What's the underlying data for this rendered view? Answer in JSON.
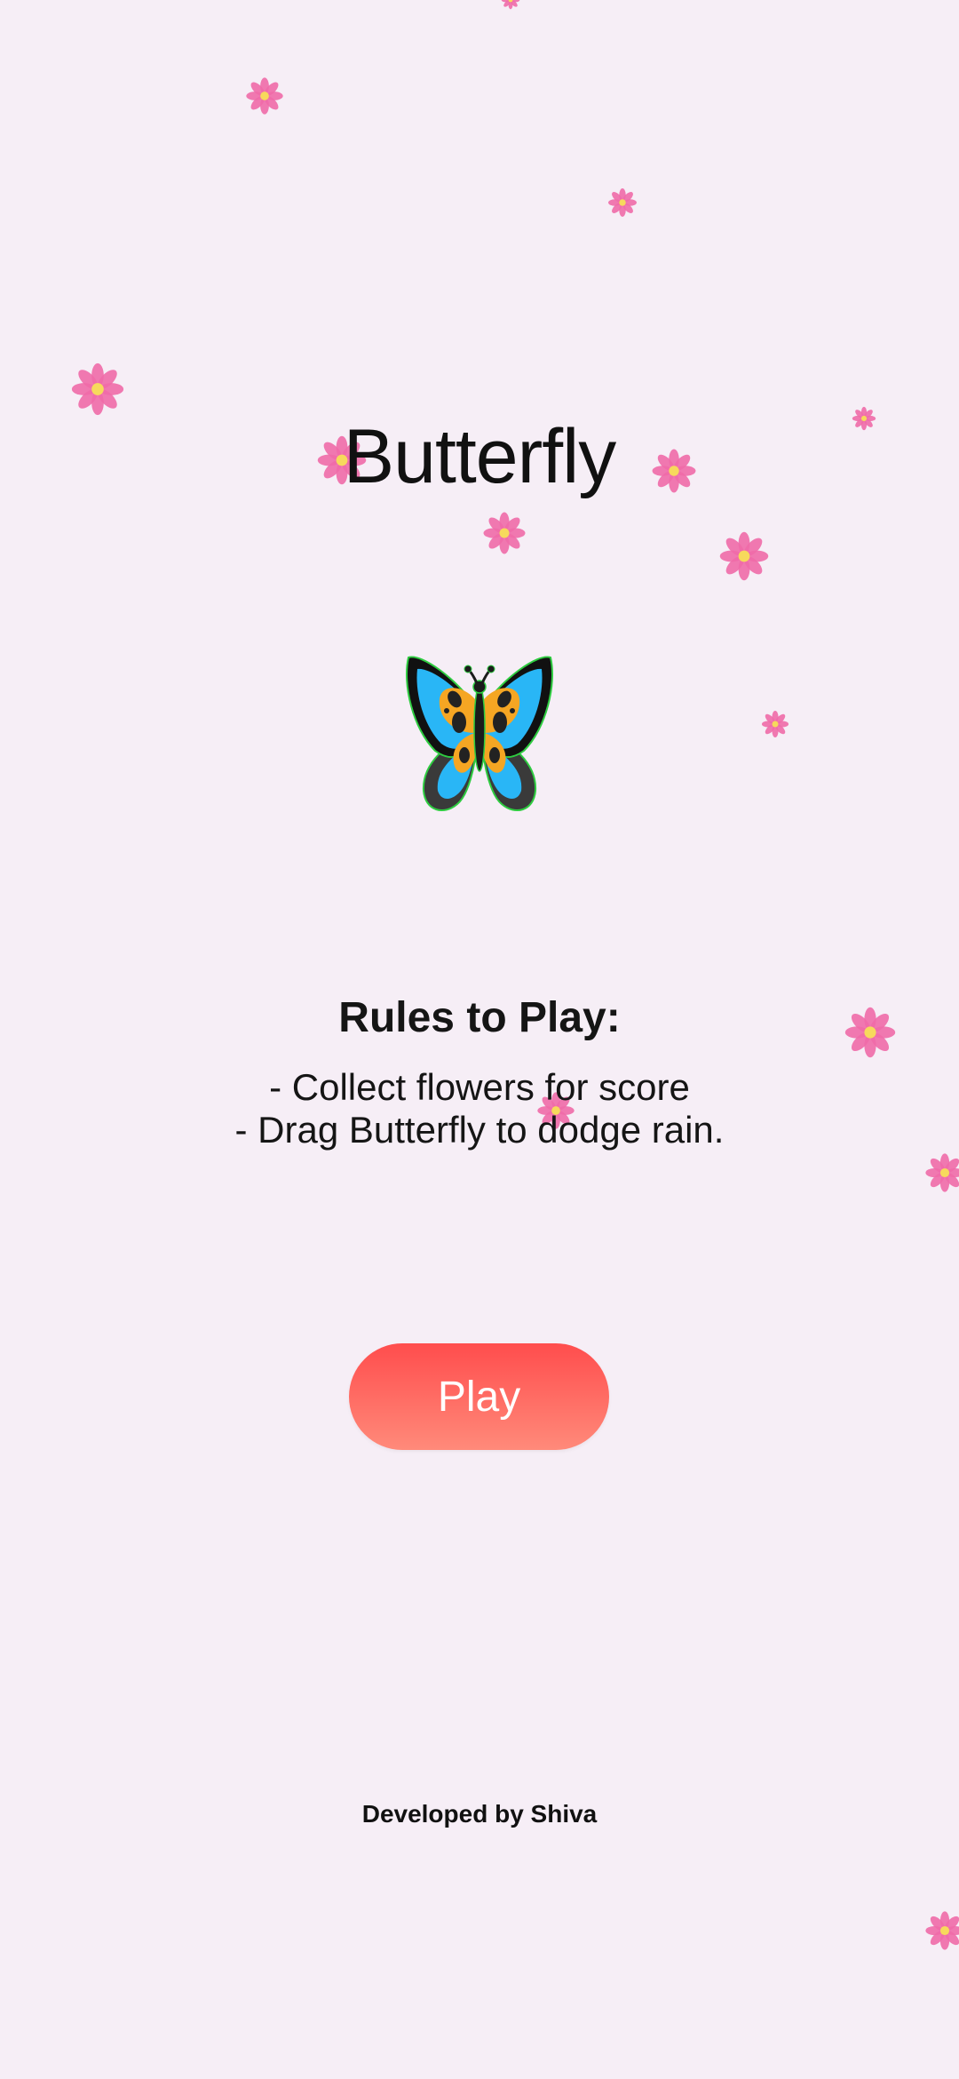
{
  "app": {
    "title": "Butterfly"
  },
  "rules": {
    "heading": "Rules to Play:",
    "items": [
      "- Collect flowers for score",
      "- Drag Butterfly to dodge rain."
    ]
  },
  "actions": {
    "play_label": "Play"
  },
  "footer": {
    "credit": "Developed by Shiva"
  },
  "colors": {
    "background": "#f6eef6",
    "play_gradient_top": "#ff4d4d",
    "play_gradient_bottom": "#ff8a7a",
    "flower_petal": "#f06aa8",
    "flower_center": "#f7d95c"
  },
  "icons": {
    "hero": "butterfly-icon",
    "falling_item": "flower-icon"
  }
}
